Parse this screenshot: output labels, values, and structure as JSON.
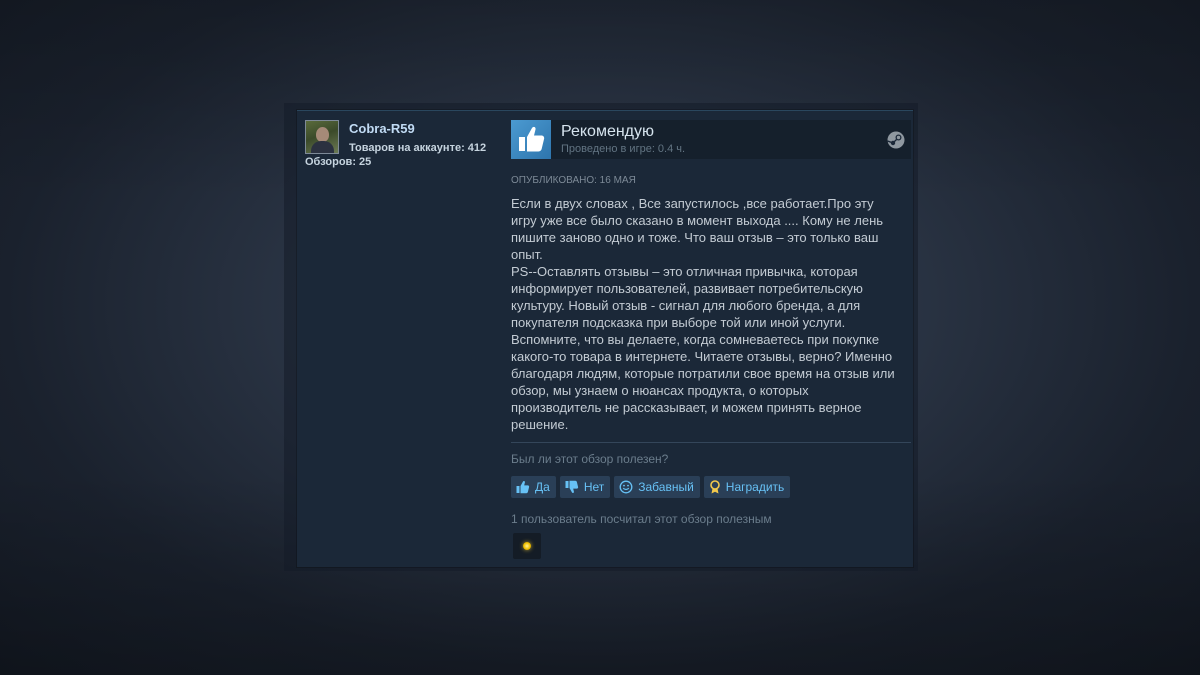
{
  "reviewer": {
    "name": "Cobra-R59",
    "games_owned": "Товаров на аккаунте: 412",
    "reviews": "Обзоров: 25"
  },
  "review": {
    "vote_title": "Рекомендую",
    "hours": "Проведено в игре: 0.4 ч.",
    "posted": "Опубликовано: 16 мая",
    "text": "Если в двух словах , Все запустилось ,все работает.Про эту\nигру уже все было сказано в момент выхода .... Кому не лень\nпишите заново одно и тоже. Что ваш отзыв – это только ваш\nопыт.\nPS--Оставлять отзывы – это отличная привычка, которая\nинформирует пользователей, развивает потребительскую\nкультуру. Новый отзыв - сигнал для любого бренда, а для\nпокупателя подсказка при выборе той или иной услуги.\nВспомните, что вы делаете, когда сомневаетесь при покупке\nкакого-то товара в интернете. Читаете отзывы, верно? Именно\nблагодаря людям, которые потратили свое время на отзыв или\nобзор, мы узнаем о нюансах продукта, о которых\nпроизводитель не рассказывает, и можем принять верное\nрешение."
  },
  "helpful": {
    "question": "Был ли этот обзор полезен?",
    "yes_label": "Да",
    "no_label": "Нет",
    "funny_label": "Забавный",
    "award_label": "Наградить",
    "summary": "1 пользователь посчитал этот обзор полезным"
  },
  "icons": {
    "vote": "thumbs-up-icon",
    "platform": "steam-icon",
    "yes": "thumbs-up-icon",
    "no": "thumbs-down-icon",
    "funny": "smile-icon",
    "award": "award-icon"
  },
  "colors": {
    "panel_bg": "#1b2838",
    "accent_link": "#67c1f5",
    "thumb_blue": "#3b8fcb"
  }
}
